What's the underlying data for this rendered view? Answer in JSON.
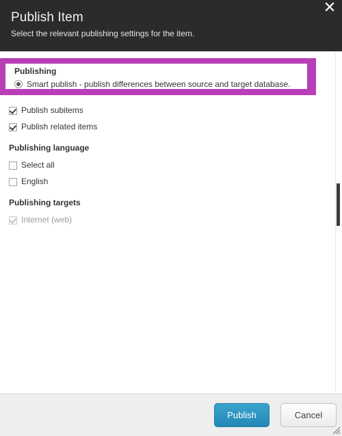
{
  "dialog": {
    "title": "Publish Item",
    "subtitle": "Select the relevant publishing settings for the item.",
    "close_icon": "close-icon"
  },
  "colors": {
    "header_background": "#2b2b2b",
    "highlight_border": "#b83fb8",
    "publish_button": "#2e96c2",
    "footer_background": "#eeeeee"
  },
  "publishing": {
    "heading": "Publishing",
    "options": [
      {
        "label": "Smart publish - publish differences between source and target database.",
        "selected": true
      }
    ]
  },
  "publish_options": [
    {
      "label": "Publish subitems",
      "checked": true,
      "disabled": false
    },
    {
      "label": "Publish related items",
      "checked": true,
      "disabled": false
    }
  ],
  "publishing_language": {
    "heading": "Publishing language",
    "items": [
      {
        "label": "Select all",
        "checked": false,
        "disabled": false
      },
      {
        "label": "English",
        "checked": false,
        "disabled": false
      }
    ]
  },
  "publishing_targets": {
    "heading": "Publishing targets",
    "items": [
      {
        "label": "Internet (web)",
        "checked": true,
        "disabled": true
      }
    ]
  },
  "footer": {
    "publish_label": "Publish",
    "cancel_label": "Cancel",
    "resize_grip_icon": "resize-grip-icon"
  }
}
